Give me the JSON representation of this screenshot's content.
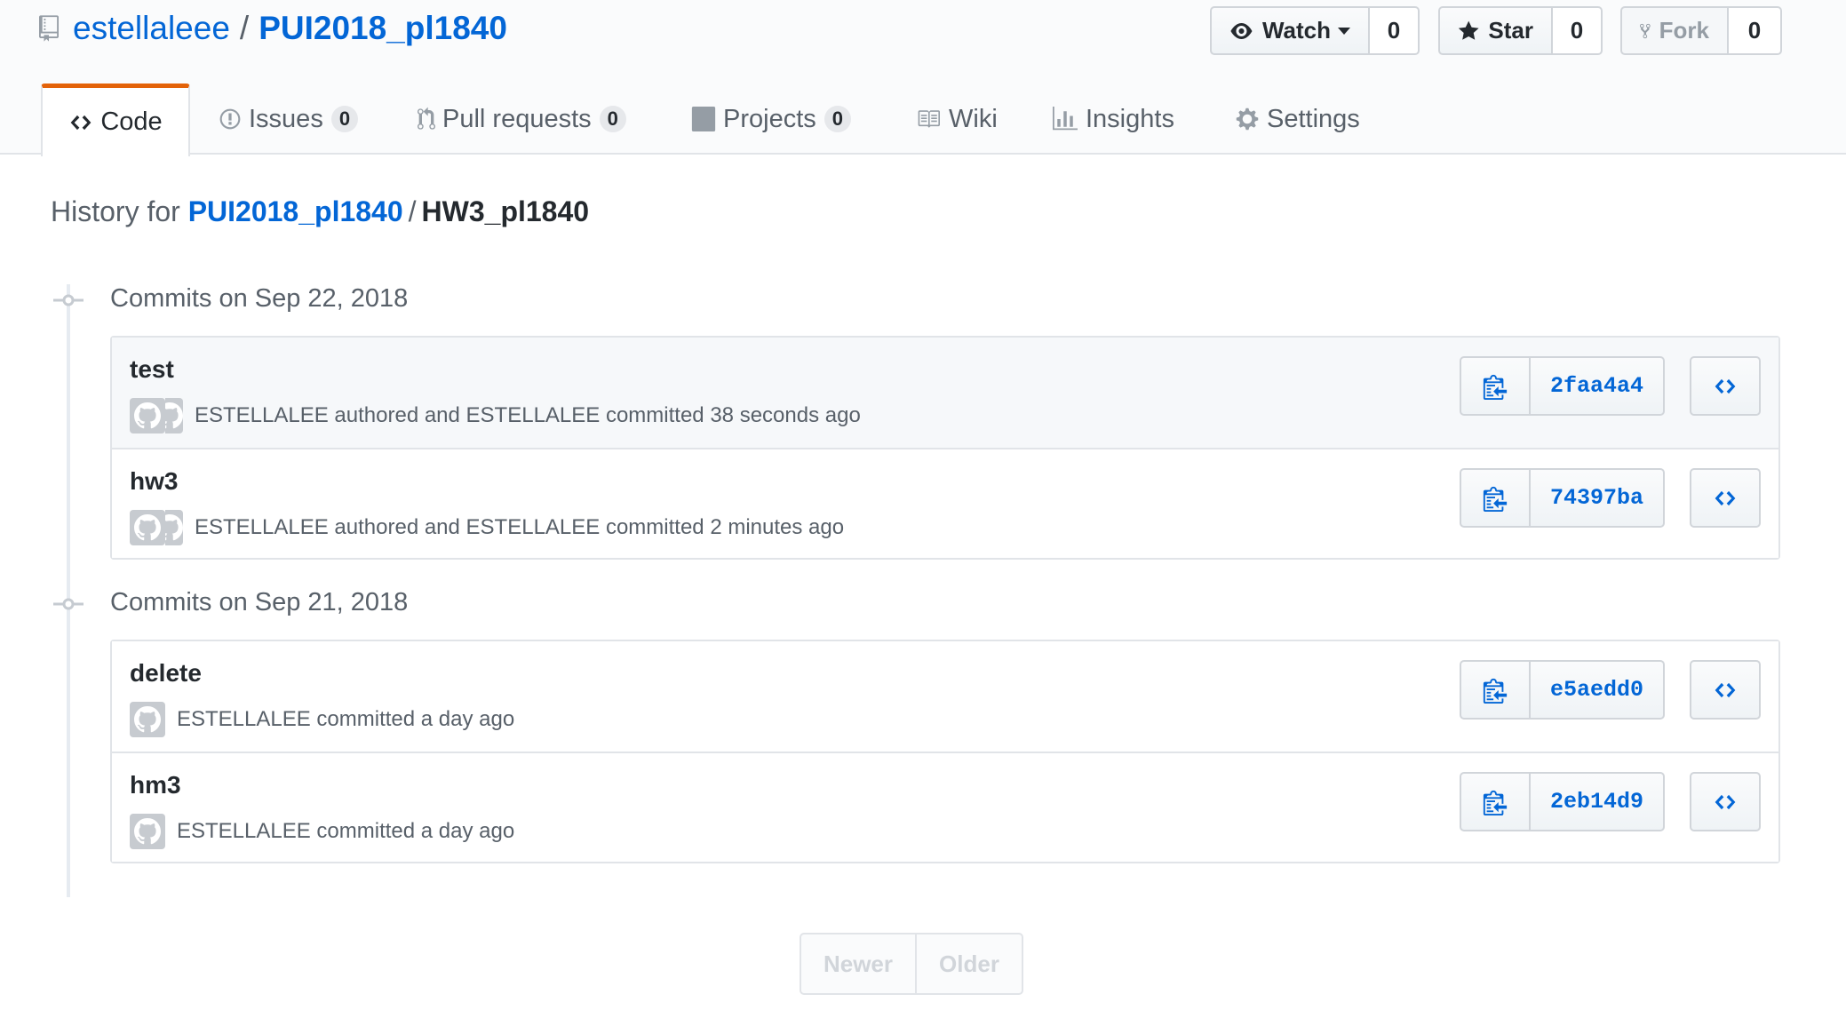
{
  "repo": {
    "owner": "estellaleee",
    "separator": "/",
    "name": "PUI2018_pl1840",
    "icon": "repo-icon"
  },
  "social": {
    "watch": {
      "label": "Watch",
      "count": "0",
      "icon": "eye-icon"
    },
    "star": {
      "label": "Star",
      "count": "0",
      "icon": "star-icon"
    },
    "fork": {
      "label": "Fork",
      "count": "0",
      "icon": "fork-icon"
    }
  },
  "tabs": [
    {
      "label": "Code",
      "icon": "code-icon",
      "selected": true
    },
    {
      "label": "Issues",
      "count": "0",
      "icon": "issue-icon"
    },
    {
      "label": "Pull requests",
      "count": "0",
      "icon": "pull-request-icon"
    },
    {
      "label": "Projects",
      "count": "0",
      "icon": "project-icon"
    },
    {
      "label": "Wiki",
      "icon": "book-icon"
    },
    {
      "label": "Insights",
      "icon": "graph-icon"
    },
    {
      "label": "Settings",
      "icon": "gear-icon"
    }
  ],
  "history": {
    "prefix": "History for",
    "repo_link": "PUI2018_pl1840",
    "separator": "/",
    "path": "HW3_pl1840"
  },
  "groups": [
    {
      "title": "Commits on Sep 22, 2018",
      "commits": [
        {
          "message": "test",
          "meta": "ESTELLALEE authored and ESTELLALEE committed 38 seconds ago",
          "sha": "2faa4a4",
          "highlight": true
        },
        {
          "message": "hw3",
          "meta": "ESTELLALEE authored and ESTELLALEE committed 2 minutes ago",
          "sha": "74397ba"
        }
      ]
    },
    {
      "title": "Commits on Sep 21, 2018",
      "commits": [
        {
          "message": "delete",
          "meta": "ESTELLALEE committed a day ago",
          "sha": "e5aedd0"
        },
        {
          "message": "hm3",
          "meta": "ESTELLALEE committed a day ago",
          "sha": "2eb14d9"
        }
      ]
    }
  ],
  "pagination": {
    "newer": "Newer",
    "older": "Older"
  },
  "colors": {
    "link": "#0366d6",
    "tab_accent": "#e36209",
    "muted": "#586069"
  }
}
